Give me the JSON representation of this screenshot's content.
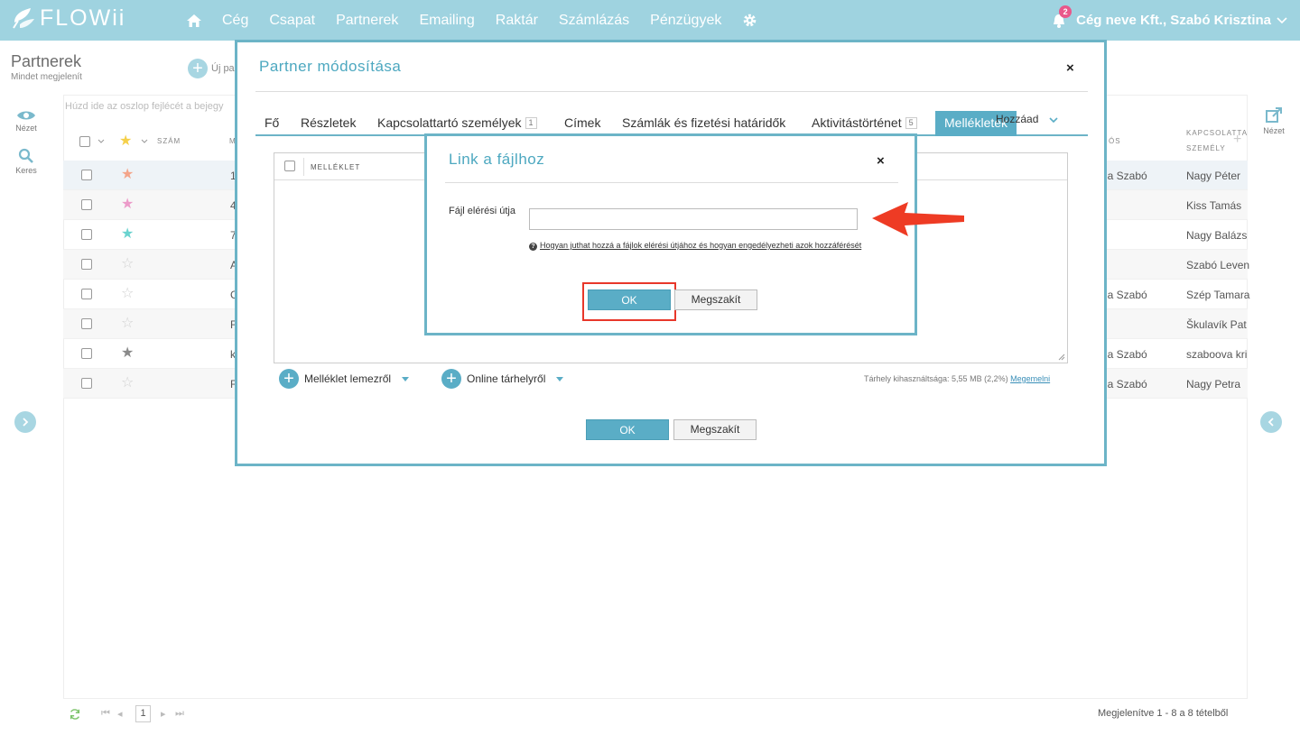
{
  "brand": {
    "name": "FLOWii"
  },
  "nav": {
    "items": [
      "Cég",
      "Csapat",
      "Partnerek",
      "Emailing",
      "Raktár",
      "Számlázás",
      "Pénzügyek"
    ],
    "notifications": "2",
    "user": "Cég neve Kft., Szabó Krisztina"
  },
  "page": {
    "title": "Partnerek",
    "subtitle": "Mindet megjelenít",
    "new_button": "Új pa",
    "group_hint": "Húzd ide az oszlop fejlécét a bejegy",
    "left_tools": [
      "Nézet",
      "Keres"
    ],
    "right_tool": "Nézet"
  },
  "grid": {
    "columns": {
      "num": "SZÁM",
      "m": "M",
      "os": "ÓS",
      "contact": "KAPCSOLATTA",
      "contact2": "SZEMÉLY"
    },
    "rows": [
      {
        "num": "1",
        "owner": "na Szabó",
        "contact": "Nagy Péter",
        "star": "#f4a58a"
      },
      {
        "num": "4",
        "owner": "",
        "contact": "Kiss Tamás",
        "star": "#ec9bc9"
      },
      {
        "num": "7",
        "owner": "",
        "contact": "Nagy Balázs",
        "star": "#6ad3cf"
      },
      {
        "num": "A",
        "owner": "",
        "contact": "Szabó Leven",
        "star": "none"
      },
      {
        "num": "C",
        "owner": "na Szabó",
        "contact": "Szép Tamara",
        "star": "none"
      },
      {
        "num": "F",
        "owner": "",
        "contact": "Škulavík Pat",
        "star": "none"
      },
      {
        "num": "k",
        "owner": "na Szabó",
        "contact": "szaboova kri",
        "star": "#8a8a8a"
      },
      {
        "num": "F",
        "owner": "na Szabó",
        "contact": "Nagy Petra",
        "star": "none"
      }
    ],
    "footer": {
      "page": "1",
      "summary": "Megjelenítve 1 - 8 a 8 tételből"
    }
  },
  "modal_partner": {
    "title": "Partner módosítása",
    "tabs": [
      {
        "label": "Fő"
      },
      {
        "label": "Részletek"
      },
      {
        "label": "Kapcsolattartó személyek",
        "badge": "1"
      },
      {
        "label": "Címek"
      },
      {
        "label": "Számlák és fizetési határidők"
      },
      {
        "label": "Aktivitástörténet",
        "badge": "5"
      },
      {
        "label": "Mellékletek",
        "active": true
      }
    ],
    "add_label": "Hozzáad",
    "attachment_column": "MELLÉKLET",
    "upload_disk": "Melléklet lemezről",
    "upload_online": "Online tárhelyről",
    "storage_text": "Tárhely kihasználtsága: 5,55 MB (2,2%)",
    "storage_link": "Megemelni",
    "ok": "OK",
    "cancel": "Megszakít"
  },
  "modal_link": {
    "title": "Link a fájlhoz",
    "field_label": "Fájl elérési útja",
    "field_value": "",
    "help": "Hogyan juthat hozzá a fájlok elérési útjához és hogyan engedélyezheti azok hozzáférését",
    "ok": "OK",
    "cancel": "Megszakít"
  },
  "colors": {
    "accent": "#5aadc6",
    "topbar": "#9fd3e0",
    "highlight": "#e8372a",
    "arrow": "#ee3b24"
  }
}
